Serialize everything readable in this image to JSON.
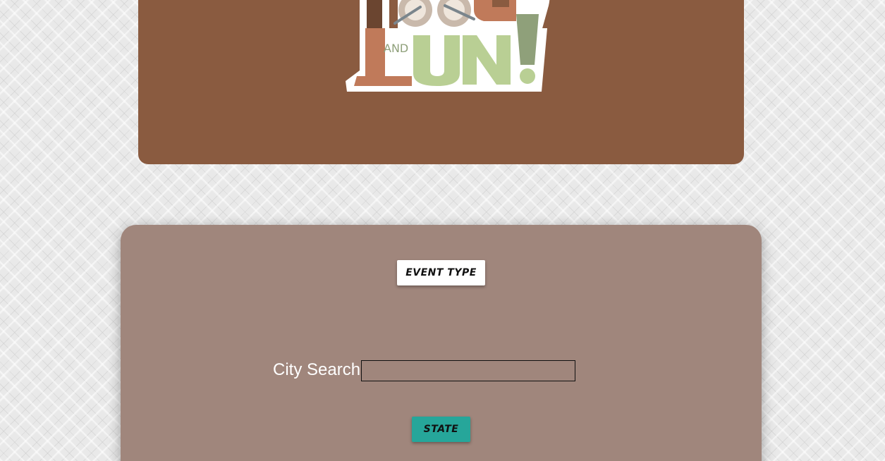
{
  "header": {
    "background_color": "#8a5b40",
    "logo": {
      "name": "food-and-fun-logo",
      "text_and": "AND",
      "text_fun": "UN!"
    }
  },
  "search_panel": {
    "background_color": "#a0867c",
    "event_type_button": "EVENT TYPE",
    "city_search_label": "City Search",
    "city_search_value": "",
    "state_button": "STATE",
    "state_button_color": "#26a69a"
  }
}
